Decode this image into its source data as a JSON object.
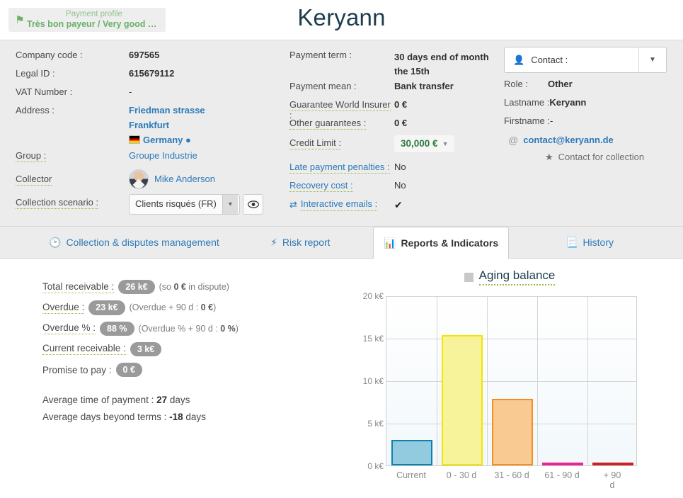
{
  "header": {
    "title": "Keryann",
    "payment_profile": {
      "label": "Payment profile",
      "value": "Très bon payeur / Very good pa...",
      "flag_color": "#67b168"
    }
  },
  "company": {
    "company_code_label": "Company code :",
    "company_code": "697565",
    "legal_id_label": "Legal ID :",
    "legal_id": "615679112",
    "vat_label": "VAT Number :",
    "vat": "-",
    "address_label": "Address :",
    "address_line1": "Friedman strasse",
    "address_line2": "Frankfurt",
    "country": "Germany",
    "group_label": "Group :",
    "group": "Groupe Industrie",
    "collector_label": "Collector",
    "collector": "Mike Anderson",
    "scenario_label": "Collection scenario :",
    "scenario_value": "Clients risqués (FR)"
  },
  "payment": {
    "term_label": "Payment term :",
    "term_value": "30 days end of month the 15th",
    "mean_label": "Payment mean :",
    "mean_value": "Bank transfer",
    "guarantee_label": "Guarantee World Insurer :",
    "guarantee_value": "0 €",
    "other_guarantees_label": "Other guarantees :",
    "other_guarantees_value": "0 €",
    "credit_limit_label": "Credit Limit :",
    "credit_limit_value": "30,000 €",
    "late_penalties_label": "Late payment penalties :",
    "late_penalties_value": "No",
    "recovery_cost_label": "Recovery cost :",
    "recovery_cost_value": "No",
    "interactive_emails_label": "Interactive emails :",
    "interactive_emails_value": "✔"
  },
  "contact": {
    "selector_label": "Contact :",
    "role_label": "Role :",
    "role_value": "Other",
    "lastname_label": "Lastname :",
    "lastname_value": "Keryann",
    "firstname_label": "Firstname :",
    "firstname_value": "-",
    "email": "contact@keryann.de",
    "collection_contact": "Contact for collection"
  },
  "tabs": [
    {
      "label": "Collection & disputes management",
      "icon": "clock-icon",
      "active": false
    },
    {
      "label": "Risk report",
      "icon": "bolt-icon",
      "active": false
    },
    {
      "label": "Reports & Indicators",
      "icon": "bar-chart-icon",
      "active": true
    },
    {
      "label": "History",
      "icon": "list-icon",
      "active": false
    }
  ],
  "indicators": {
    "total_receivable_label": "Total receivable :",
    "total_receivable_value": "26 k€",
    "total_receivable_note_pre": "(so ",
    "total_receivable_note_b": "0 €",
    "total_receivable_note_post": " in dispute)",
    "overdue_label": "Overdue :",
    "overdue_value": "23 k€",
    "overdue_note_pre": "(Overdue + 90 d : ",
    "overdue_note_b": "0 €",
    "overdue_note_post": ")",
    "overdue_pct_label": "Overdue % :",
    "overdue_pct_value": "88 %",
    "overdue_pct_note_pre": "(Overdue % + 90 d : ",
    "overdue_pct_note_b": "0 %",
    "overdue_pct_note_post": ")",
    "current_receivable_label": "Current receivable :",
    "current_receivable_value": "3 k€",
    "promise_label": "Promise to pay :",
    "promise_value": "0 €",
    "avg_time_label_pre": "Average time of payment : ",
    "avg_time_value": "27",
    "avg_time_label_post": " days",
    "avg_dbt_label_pre": "Average days beyond terms : ",
    "avg_dbt_value": "-18",
    "avg_dbt_label_post": " days"
  },
  "chart_data": {
    "type": "bar",
    "title": "Aging balance",
    "xlabel": "",
    "ylabel": "",
    "ylim": [
      0,
      20
    ],
    "yticks": [
      0,
      5,
      10,
      15,
      20
    ],
    "ytick_labels": [
      "0 k€",
      "5 k€",
      "10 k€",
      "15 k€",
      "20 k€"
    ],
    "grid": true,
    "legend_position": "top",
    "categories": [
      "Current",
      "0 - 30 d",
      "31 - 60 d",
      "61 - 90 d",
      "+ 90 d"
    ],
    "values": [
      3.0,
      15.3,
      7.8,
      0.12,
      0.06
    ],
    "bar_fill_colors": [
      "#92cbdf",
      "#f6f39a",
      "#f9cb92",
      "#ec2296",
      "#cc2222"
    ],
    "bar_border_colors": [
      "#0f7fae",
      "#f5e300",
      "#f68c22",
      "#ec2296",
      "#cc2222"
    ]
  }
}
